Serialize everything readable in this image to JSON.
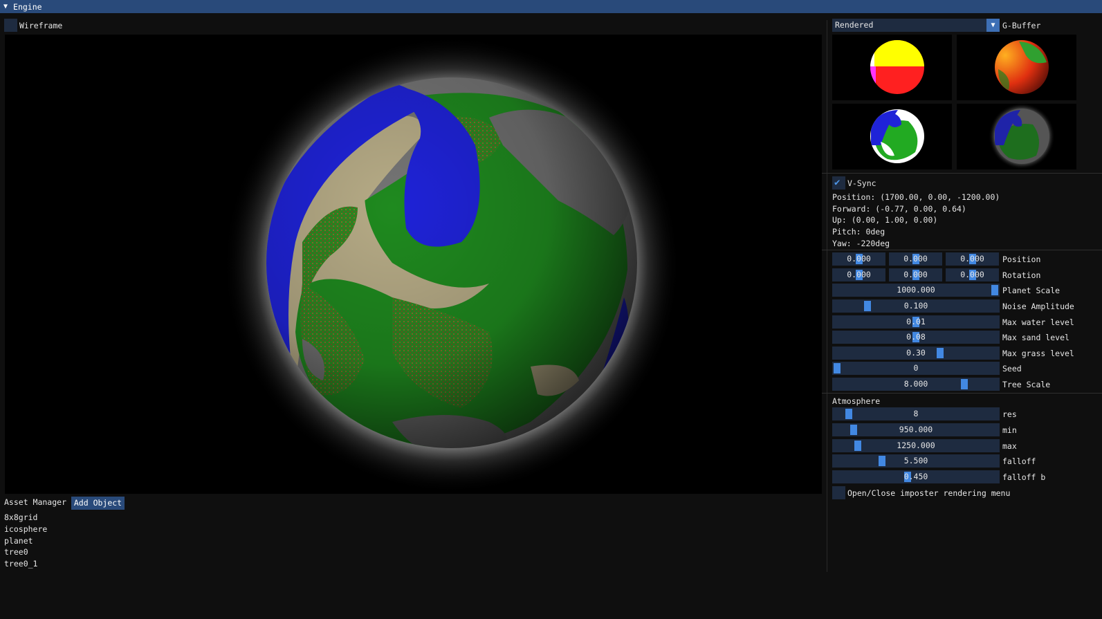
{
  "window": {
    "title": "Engine"
  },
  "viewport_panel": {
    "wireframe_label": "Wireframe",
    "wireframe_checked": false
  },
  "render_mode": {
    "selected": "Rendered",
    "gbuffer_label": "G-Buffer"
  },
  "camera": {
    "vsync_label": "V-Sync",
    "vsync_checked": true,
    "position": "Position: (1700.00, 0.00, -1200.00)",
    "forward": "Forward: (-0.77, 0.00, 0.64)",
    "up": "Up: (0.00, 1.00, 0.00)",
    "pitch": "Pitch: 0deg",
    "yaw": "Yaw: -220deg"
  },
  "transform": {
    "position_label": "Position",
    "rotation_label": "Rotation",
    "position": [
      "0.000",
      "0.000",
      "0.000"
    ],
    "rotation": [
      "0.000",
      "0.000",
      "0.000"
    ]
  },
  "planet": [
    {
      "label": "Planet Scale",
      "value": "1000.000",
      "level": 1.0
    },
    {
      "label": "Noise Amplitude",
      "value": "0.100",
      "level": 0.2
    },
    {
      "label": "Max water level",
      "value": "0.01",
      "level": 0.5
    },
    {
      "label": "Max sand level",
      "value": "0.08",
      "level": 0.5
    },
    {
      "label": "Max grass level",
      "value": "0.30",
      "level": 0.65
    },
    {
      "label": "Seed",
      "value": "0",
      "level": 0.0
    },
    {
      "label": "Tree Scale",
      "value": "8.000",
      "level": 0.8
    }
  ],
  "atmosphere": {
    "header": "Atmosphere",
    "params": [
      {
        "label": "res",
        "value": "8",
        "level": 0.08
      },
      {
        "label": "min",
        "value": "950.000",
        "level": 0.11
      },
      {
        "label": "max",
        "value": "1250.000",
        "level": 0.14
      },
      {
        "label": "falloff",
        "value": "5.500",
        "level": 0.29
      },
      {
        "label": "falloff b",
        "value": "0.450",
        "level": 0.45
      }
    ]
  },
  "imposter": {
    "label": "Open/Close imposter rendering menu",
    "checked": false
  },
  "assets": {
    "title": "Asset Manager",
    "add_label": "Add Object",
    "items": [
      "8x8grid",
      "icosphere",
      "planet",
      "tree0",
      "tree0_1"
    ]
  },
  "colors": {
    "title_bar": "#294a7a",
    "frame_bg": "#1e2b40",
    "slider_grab": "#4288e2",
    "checkmark": "#4e97e8",
    "planet_water": "#1f23d8",
    "planet_grass": "#1f8a1f",
    "planet_sand": "#b6ab86",
    "planet_rock": "#6a6a6a"
  }
}
